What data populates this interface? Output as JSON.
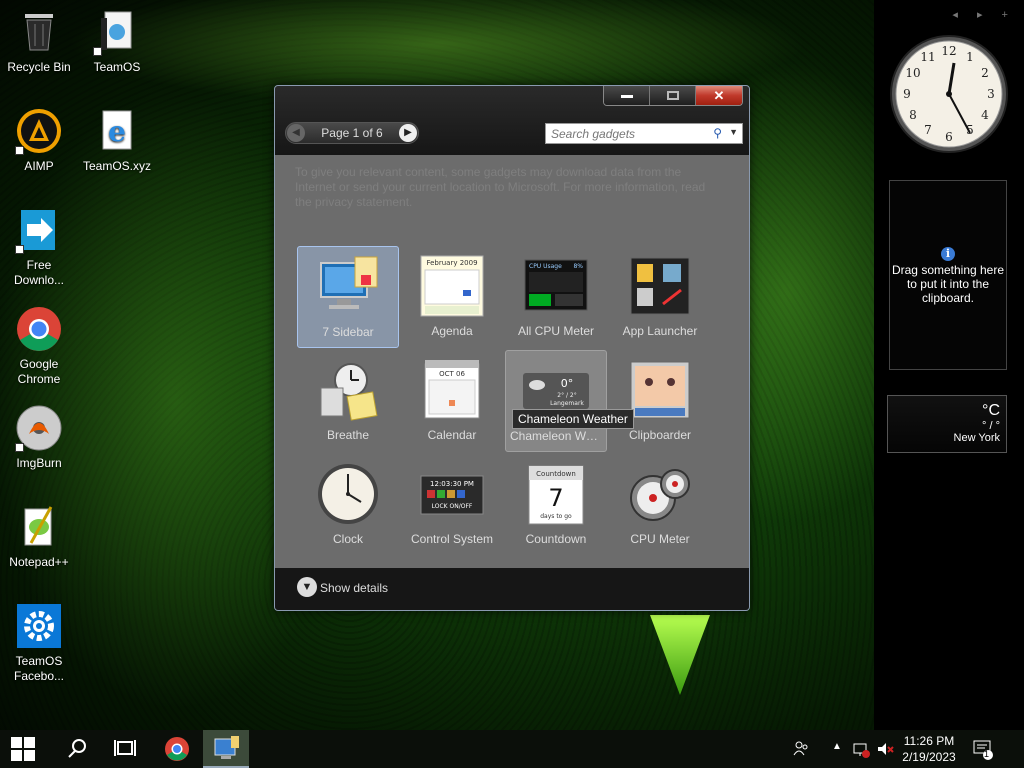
{
  "desktop": {
    "icons": [
      {
        "label": "Recycle Bin",
        "icon": "recycle-bin-icon"
      },
      {
        "label": "TeamOS",
        "icon": "teamos-folder-icon"
      },
      {
        "label": "AIMP",
        "icon": "aimp-icon"
      },
      {
        "label": "TeamOS.xyz",
        "icon": "ie-shortcut-icon"
      },
      {
        "label": "Free Downlo...",
        "icon": "free-download-icon"
      },
      {
        "label": "Google Chrome",
        "icon": "chrome-icon"
      },
      {
        "label": "ImgBurn",
        "icon": "imgburn-icon"
      },
      {
        "label": "Notepad++",
        "icon": "notepadpp-icon"
      },
      {
        "label": "TeamOS Facebo...",
        "icon": "gear-icon"
      }
    ]
  },
  "gadget_window": {
    "pager_text": "Page 1 of 6",
    "search_placeholder": "Search gadgets",
    "privacy_text": "To give you relevant content, some gadgets may download data from the Internet or send your current location to Microsoft. For more information, read the privacy statement.",
    "gadgets": [
      {
        "label": "7 Sidebar",
        "state": "selected"
      },
      {
        "label": "Agenda"
      },
      {
        "label": "All CPU Meter"
      },
      {
        "label": "App Launcher"
      },
      {
        "label": "Breathe"
      },
      {
        "label": "Calendar"
      },
      {
        "label": "Chameleon We...",
        "state": "hover"
      },
      {
        "label": "Clipboarder"
      },
      {
        "label": "Clock"
      },
      {
        "label": "Control System"
      },
      {
        "label": "Countdown"
      },
      {
        "label": "CPU Meter"
      }
    ],
    "tooltip": "Chameleon Weather",
    "details_label": "Show details",
    "thumb_text": {
      "agenda_header": "February 2009",
      "cpu_header": "CPU Usage",
      "cpu_pct": "8%",
      "calendar_month": "OCT 06",
      "weather_temp": "0°",
      "weather_range": "2° / 2°",
      "weather_city": "Langemark",
      "control_time": "12:03:30 PM",
      "control_lock": "LOCK ON/OFF",
      "countdown_title": "Countdown",
      "countdown_num": "7",
      "countdown_sub": "days to go"
    }
  },
  "sidebar": {
    "nav": "◂ ▸ +",
    "clipboard_text": "Drag something here to put it into the clipboard.",
    "weather_unit": "°C",
    "weather_temp": "° / °",
    "weather_city": "New York"
  },
  "taskbar": {
    "time": "11:26 PM",
    "date": "2/19/2023",
    "notification_count": "1"
  }
}
